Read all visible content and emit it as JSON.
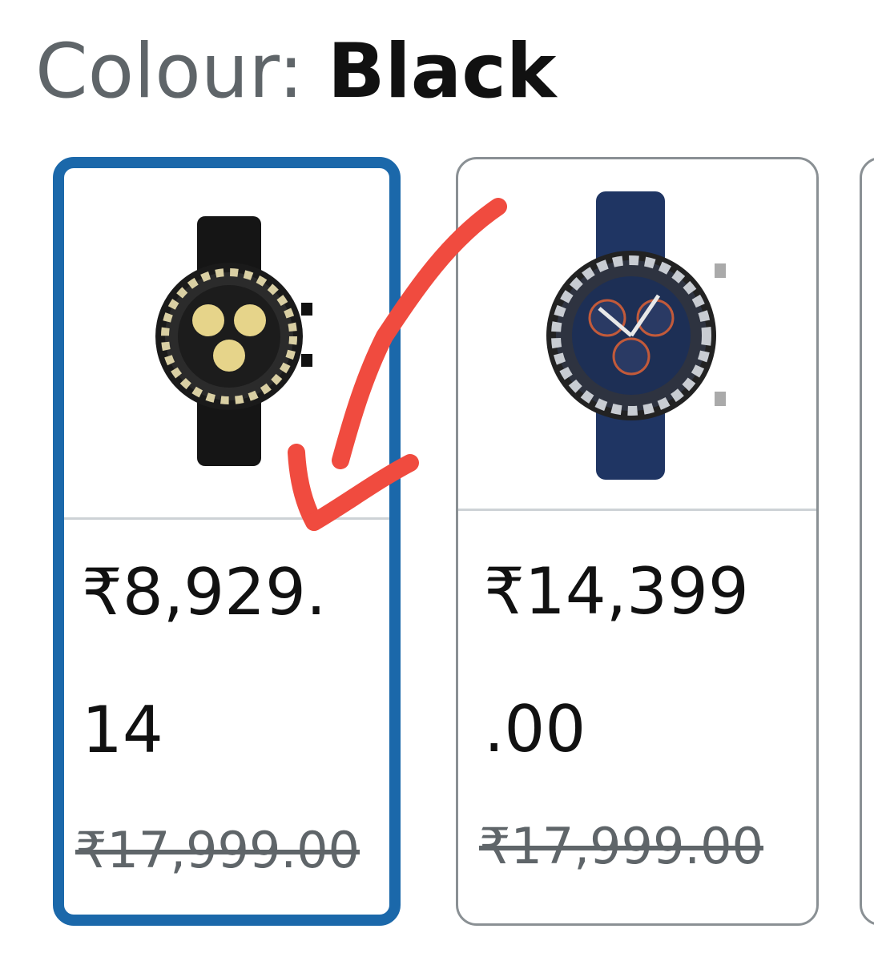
{
  "colour": {
    "label": "Colour: ",
    "value": "Black"
  },
  "swatches": [
    {
      "price_line1": "₹8,929.",
      "price_line2": "14",
      "mrp": "₹17,999.00",
      "selected": true,
      "dial_color": "#e6d48a",
      "strap_color": "#151515"
    },
    {
      "price_line1": "₹14,399",
      "price_line2": ".00",
      "mrp": "₹17,999.00",
      "selected": false,
      "dial_color": "#1d2f55",
      "strap_color": "#1f3563"
    }
  ],
  "colors": {
    "selected_border": "#1b68aa",
    "unselected_border": "#8a9094",
    "annotation_arrow": "#f04b3f"
  }
}
